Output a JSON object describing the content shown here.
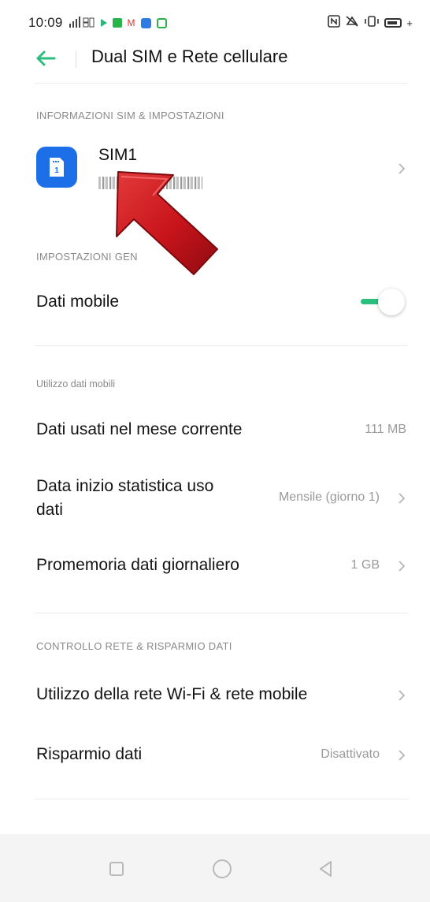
{
  "status_bar": {
    "time": "10:09",
    "left_indicators": [
      "signal-icon",
      "notification-icons"
    ],
    "right_indicators": [
      "nfc-icon",
      "mute-icon",
      "vibrate-icon",
      "battery-icon"
    ]
  },
  "app_bar": {
    "title": "Dual SIM e Rete cellulare",
    "back_icon": "back-arrow-icon",
    "accent_color": "#2bbf7e"
  },
  "sim_section": {
    "header": "INFORMAZIONI SIM & IMPOSTAZIONI",
    "sim": {
      "name": "SIM1",
      "icon": "sim-card-icon",
      "icon_color": "#1d6fe8"
    }
  },
  "general_section": {
    "header": "IMPOSTAZIONI GEN",
    "mobile_data": {
      "label": "Dati mobile",
      "enabled": true
    }
  },
  "usage_section": {
    "header": "Utilizzo dati mobili",
    "items": [
      {
        "label": "Dati usati nel mese corrente",
        "value": "111 MB"
      },
      {
        "label": "Data inizio statistica uso dati",
        "value": "Mensile (giorno 1)"
      },
      {
        "label": "Promemoria dati giornaliero",
        "value": "1 GB"
      }
    ]
  },
  "network_section": {
    "header": "CONTROLLO RETE & RISPARMIO DATI",
    "items": [
      {
        "label": "Utilizzo della rete Wi-Fi & rete mobile",
        "value": ""
      },
      {
        "label": "Risparmio dati",
        "value": "Disattivato"
      }
    ]
  },
  "annotation": {
    "type": "red-arrow-pointing-to-sim1",
    "color": "#c8141b"
  },
  "nav_bar": {
    "buttons": [
      "recents-square-icon",
      "home-circle-icon",
      "back-triangle-icon"
    ]
  }
}
